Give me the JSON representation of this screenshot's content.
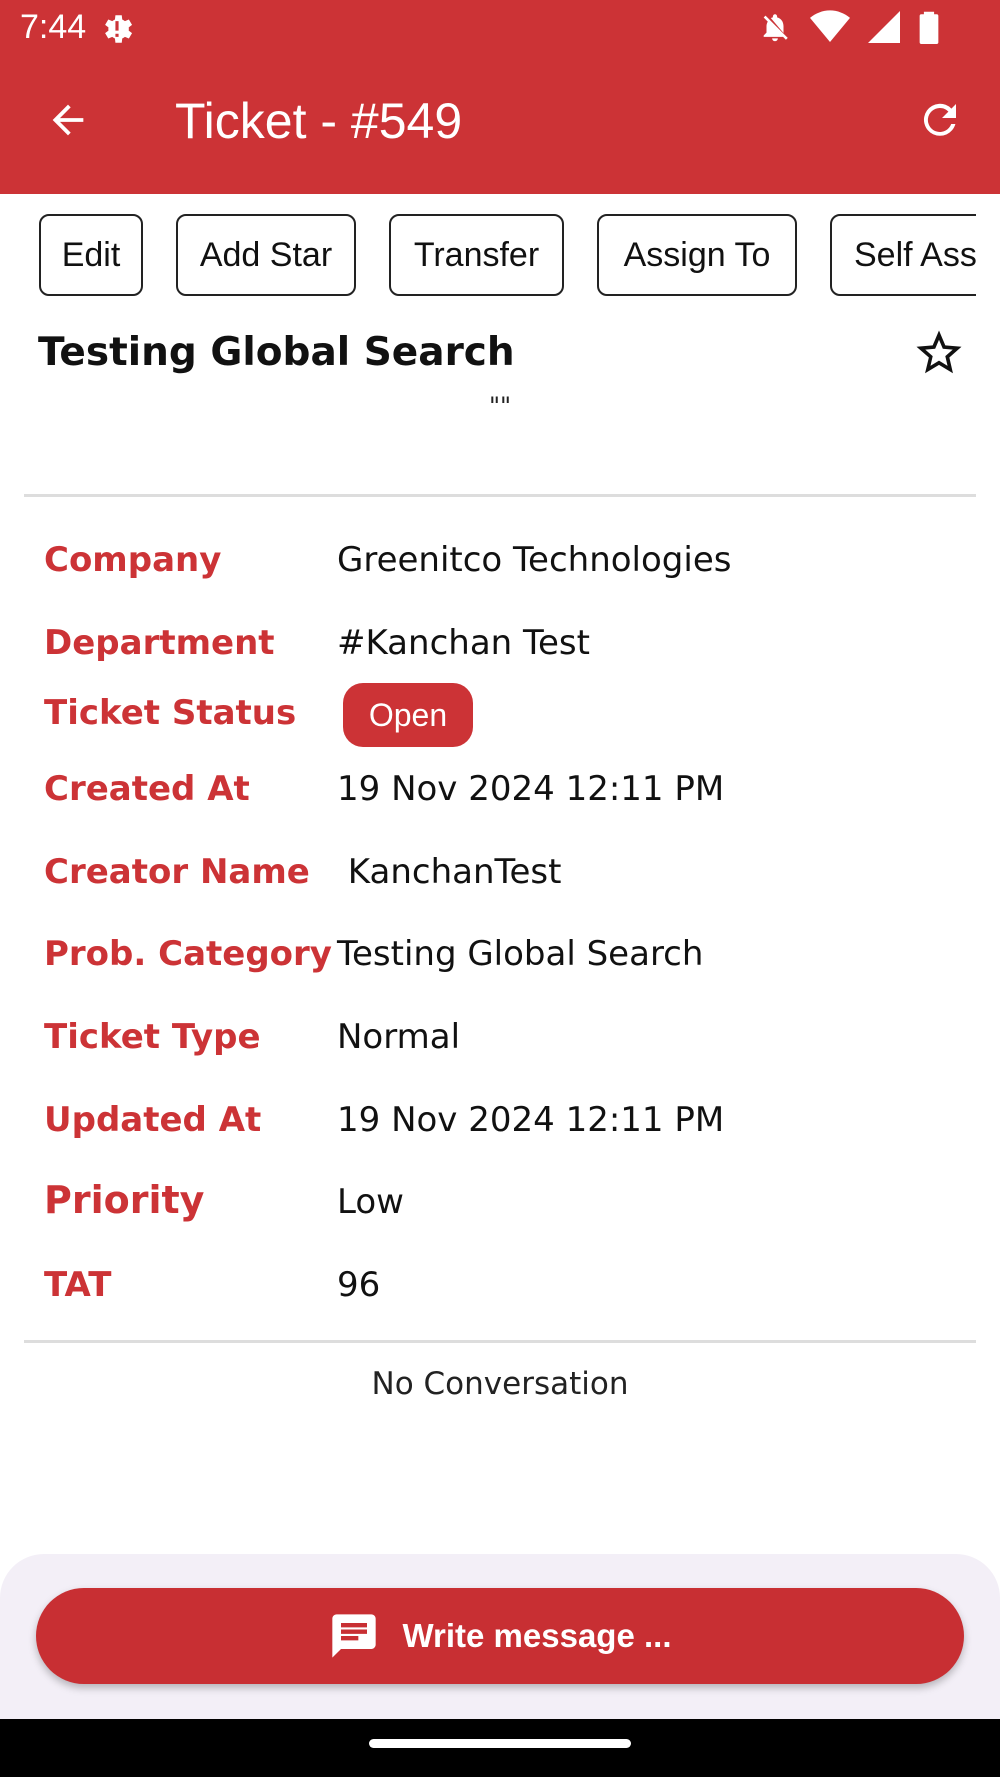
{
  "status_bar": {
    "time": "7:44",
    "icons": [
      "gear-icon",
      "notifications-off-icon",
      "wifi-icon",
      "cellular-icon",
      "battery-icon"
    ]
  },
  "app_bar": {
    "title": "Ticket - #549",
    "back_icon": "arrow-back-icon",
    "refresh_icon": "refresh-icon"
  },
  "actions": [
    {
      "label": "Edit"
    },
    {
      "label": "Add Star"
    },
    {
      "label": "Transfer"
    },
    {
      "label": "Assign To"
    },
    {
      "label": "Self Assign"
    }
  ],
  "ticket": {
    "title": "Testing Global Search",
    "description": "\"\"",
    "star_icon": "star-outline-icon"
  },
  "details": {
    "company": {
      "label": "Company",
      "value": "Greenitco Technologies"
    },
    "department": {
      "label": "Department",
      "value": "#Kanchan Test"
    },
    "status": {
      "label": "Ticket Status",
      "value": "Open"
    },
    "created_at": {
      "label": "Created At",
      "value": "19 Nov 2024 12:11 PM"
    },
    "creator_name": {
      "label": "Creator Name",
      "value": " KanchanTest"
    },
    "prob_category": {
      "label": "Prob. Category",
      "value": "Testing Global Search"
    },
    "ticket_type": {
      "label": "Ticket Type",
      "value": "Normal"
    },
    "updated_at": {
      "label": "Updated At",
      "value": "19 Nov 2024 12:11 PM"
    },
    "priority": {
      "label": "Priority",
      "value": "Low"
    },
    "tat": {
      "label": "TAT",
      "value": "96"
    }
  },
  "conversation": {
    "empty_text": "No Conversation"
  },
  "composer": {
    "button_label": "Write message ...",
    "icon": "message-icon"
  },
  "colors": {
    "primary": "#cc3336",
    "footer_bg": "#f3eff7"
  }
}
